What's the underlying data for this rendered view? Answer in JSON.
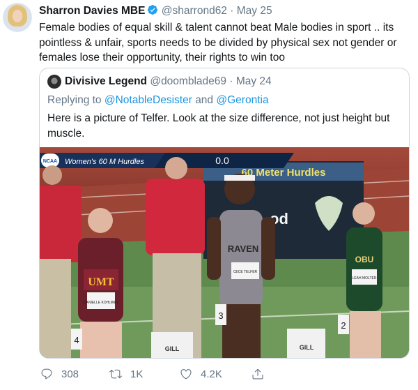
{
  "tweet": {
    "name": "Sharron Davies MBE",
    "handle": "@sharrond62",
    "separator": "·",
    "date": "May 25",
    "text": "Female bodies of equal skill & talent cannot beat Male bodies in sport .. its pointless & unfair, sports needs to be divided by physical sex not gender or females lose their opportunity, their rights to win too"
  },
  "quote": {
    "name": "Divisive Legend",
    "handle": "@doomblade69",
    "separator": "·",
    "date": "May 24",
    "reply_prefix": "Replying to",
    "reply_mention_1": "@NotableDesister",
    "reply_and": "and",
    "reply_mention_2": "@Gerontia",
    "text": "Here is a picture of Telfer. Look at the size difference, not just height but muscle.",
    "photo": {
      "ncaa": "NCAA",
      "event": "Women's 60 M Hurdles",
      "timer": "0.0",
      "board": "60 Meter Hurdles",
      "board_word": "od",
      "left_jersey": "UMT",
      "left_bib": "DANIELLE KOHLWEY",
      "left_lane": "4",
      "center_jersey": "RAVEN",
      "center_bib": "CECE TELFER",
      "center_lane": "3",
      "right_jersey": "OBU",
      "right_bib": "LEAH MOLTER",
      "right_lane": "2",
      "block_brand_1": "GILL",
      "block_brand_2": "GILL"
    }
  },
  "actions": {
    "replies": "308",
    "retweets": "1K",
    "likes": "4.2K"
  },
  "colors": {
    "link": "#1b95e0",
    "secondary": "#657786",
    "verified": "#1da1f2",
    "border": "#ccd6dd"
  },
  "icons": [
    "verified-icon",
    "reply-icon",
    "retweet-icon",
    "like-icon",
    "share-icon"
  ]
}
